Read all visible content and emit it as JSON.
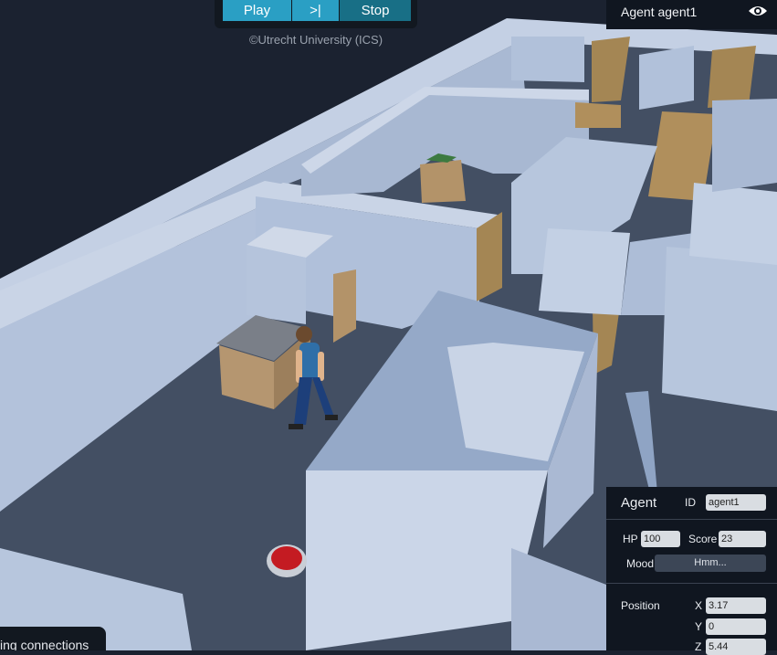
{
  "controls": {
    "play_label": "Play",
    "step_label": ">|",
    "stop_label": "Stop",
    "credit": "©Utrecht University (ICS)"
  },
  "agent_header": {
    "title": "Agent agent1",
    "visibility_icon": "eye-icon"
  },
  "agent_panel": {
    "title": "Agent",
    "id_label": "ID",
    "id_value": "agent1",
    "hp_label": "HP",
    "hp_value": "100",
    "score_label": "Score",
    "score_value": "23",
    "mood_label": "Mood",
    "mood_value": "Hmm...",
    "position_label": "Position",
    "x_label": "X",
    "x_value": "3.17",
    "y_label": "Y",
    "y_value": "0",
    "z_label": "Z",
    "z_value": "5.44"
  },
  "status": {
    "text": "ing connections"
  },
  "colors": {
    "background": "#1b2230",
    "floor": "#434f63",
    "wall": "#b7c6dd",
    "door": "#a48654",
    "button_active": "#2a9fc4",
    "button_stop": "#186f86",
    "panel": "#101620",
    "goal_button": "#c41b22"
  }
}
